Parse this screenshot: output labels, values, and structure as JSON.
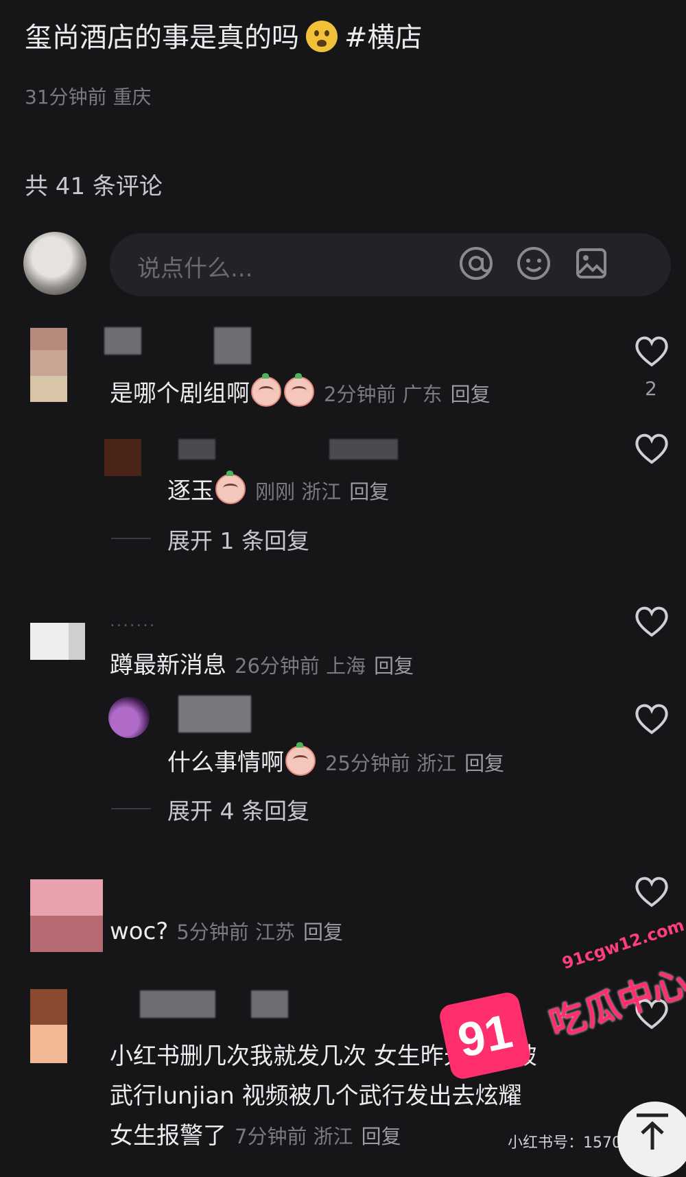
{
  "post": {
    "title": "玺尚酒店的事是真的吗",
    "emoji": "worried-face-emoji",
    "hashtag": "#横店",
    "meta": "31分钟前 重庆"
  },
  "comments_header": {
    "count_text": "共 41 条评论"
  },
  "composer": {
    "placeholder": "说点什么...",
    "icons": [
      "at-icon",
      "emoji-icon",
      "image-icon"
    ]
  },
  "comments": [
    {
      "text": "是哪个剧组啊",
      "emojis": 2,
      "meta": "2分钟前 广东",
      "reply": "回复",
      "likes": "2"
    },
    {
      "text": "逐玉",
      "emojis": 1,
      "meta": "刚刚 浙江",
      "reply": "回复",
      "expand": "展开 1 条回复"
    },
    {
      "text": "蹲最新消息",
      "meta": "26分钟前 上海",
      "reply": "回复"
    },
    {
      "text": "什么事情啊",
      "emojis": 1,
      "meta": "25分钟前 浙江",
      "reply": "回复",
      "expand": "展开 4 条回复"
    },
    {
      "text": "woc?",
      "meta": "5分钟前 江苏",
      "reply": "回复"
    },
    {
      "lines": [
        "小红书删几次我就发几次  女生昨天晚上被",
        "武行lunjian  视频被几个武行发出去炫耀",
        "女生报警了"
      ],
      "meta": "7分钟前 浙江",
      "reply": "回复"
    }
  ],
  "watermark": {
    "domain": "91cgw12.com",
    "badge": "91",
    "name": "吃瓜中心"
  },
  "bottom_partial": "小红书号：15704"
}
